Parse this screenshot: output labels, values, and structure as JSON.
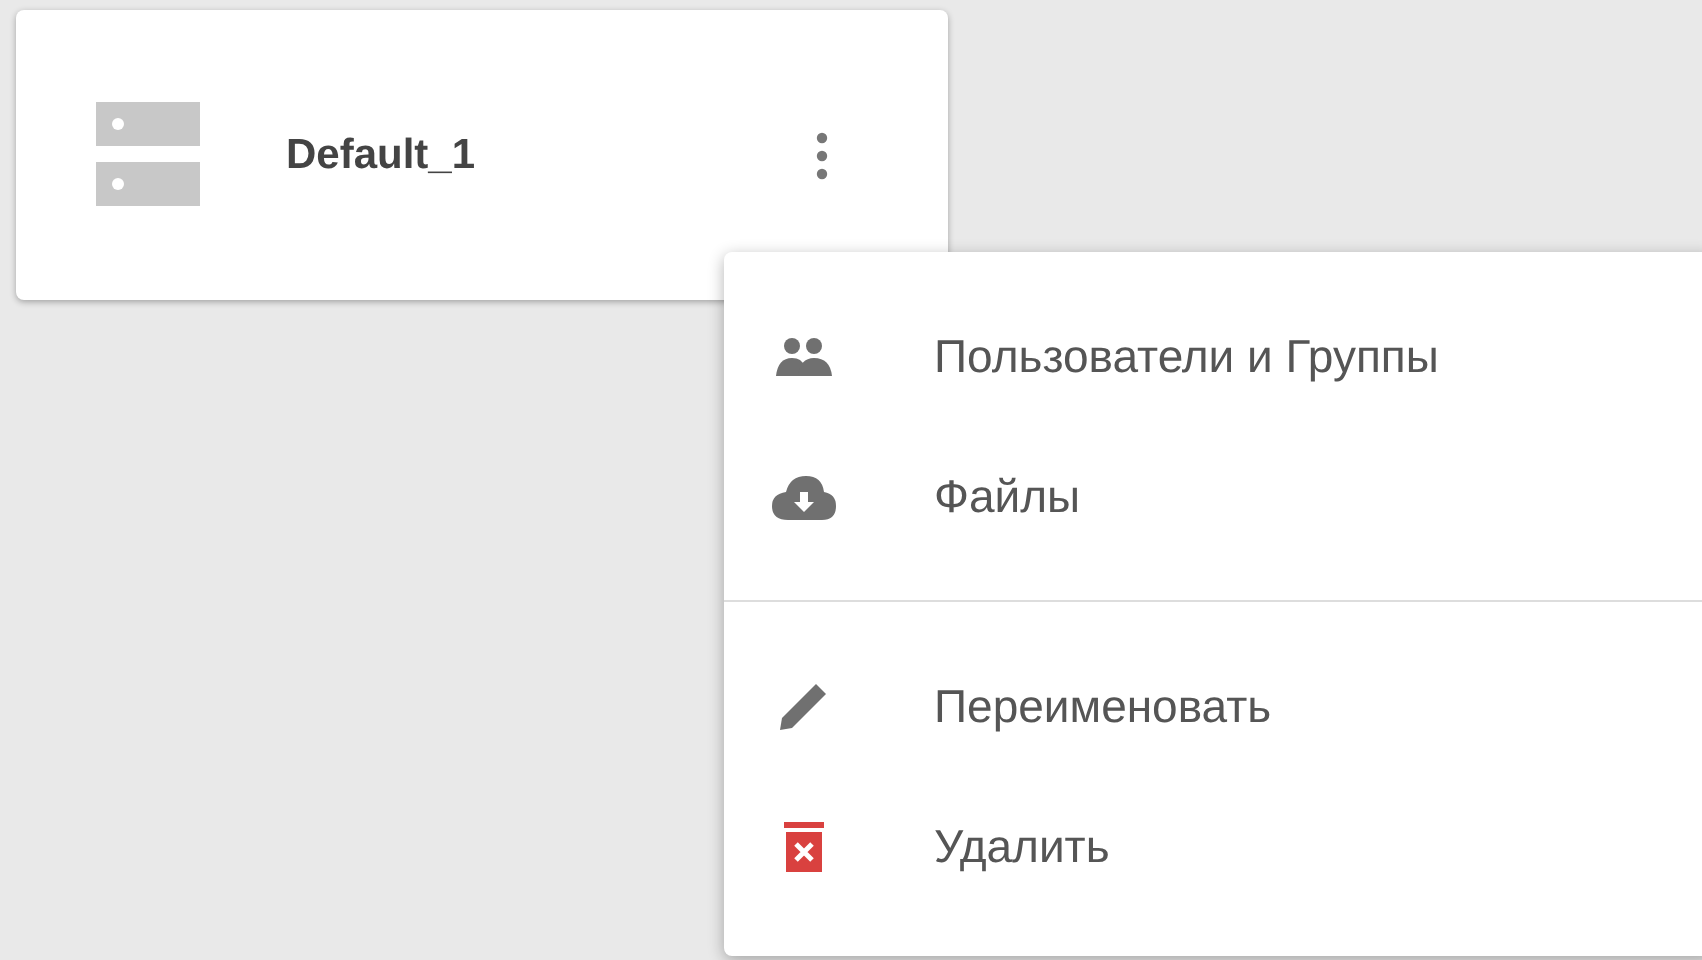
{
  "card": {
    "title": "Default_1"
  },
  "menu": {
    "groups": [
      [
        {
          "kind": "users",
          "label": "Пользователи и Группы"
        },
        {
          "kind": "files",
          "label": "Файлы"
        }
      ],
      [
        {
          "kind": "rename",
          "label": "Переименовать"
        },
        {
          "kind": "delete",
          "label": "Удалить"
        }
      ]
    ]
  }
}
